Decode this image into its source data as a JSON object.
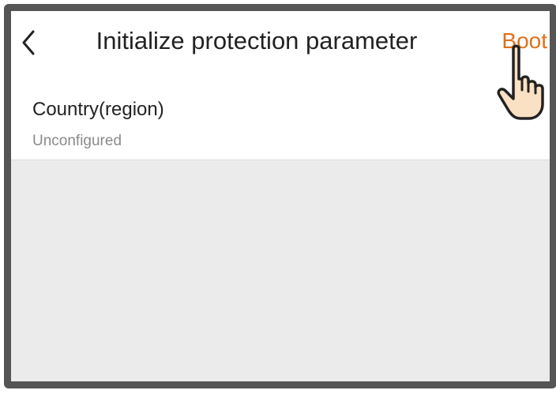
{
  "header": {
    "back_icon": "chevron-left-icon",
    "title": "Initialize protection parameter",
    "action_label": "Boot",
    "accent_color": "#e0701c"
  },
  "settings": {
    "country": {
      "label": "Country(region)",
      "value": "Unconfigured"
    }
  },
  "overlay": {
    "pointer_icon": "tap-hand-icon"
  }
}
